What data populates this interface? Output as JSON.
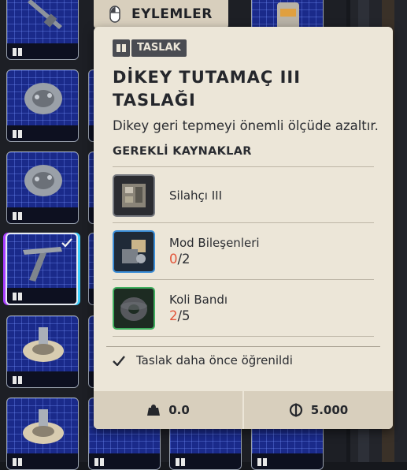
{
  "actions_tab": {
    "label": "EYLEMLER",
    "icon": "mouse-icon"
  },
  "tooltip": {
    "badge": {
      "label": "TASLAK",
      "icon": "blueprint-icon"
    },
    "title": "DİKEY TUTAMAÇ III TASLAĞI",
    "description": "Dikey geri tepmeyi önemli ölçüde azaltır.",
    "resources_heading": "GEREKLİ KAYNAKLAR",
    "resources": [
      {
        "name": "Silahçı III",
        "have": "",
        "need": "",
        "icon": "workbench-icon",
        "frame": "gray"
      },
      {
        "name": "Mod Bileşenleri",
        "have": "0",
        "need": "/2",
        "icon": "mod-components-icon",
        "frame": "blue"
      },
      {
        "name": "Koli Bandı",
        "have": "2",
        "need": "/5",
        "icon": "duct-tape-icon",
        "frame": "green"
      }
    ],
    "learned_text": "Taslak daha önce öğrenildi",
    "footer": {
      "weight": "0.0",
      "price": "5.000"
    }
  },
  "colors": {
    "panel": "#ece6d8",
    "panel_footer": "#d8cfbd",
    "missing": "#e2553a",
    "slot_grid": "#1a2a8a"
  }
}
